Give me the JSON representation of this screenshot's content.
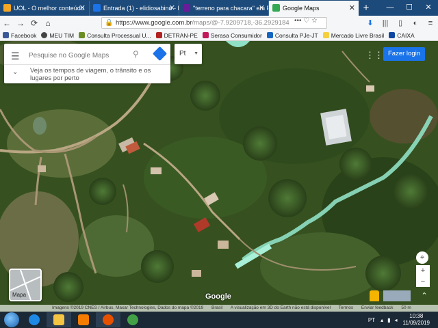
{
  "tabs": [
    {
      "title": "UOL - O melhor conteúdo",
      "favicon_color": "#f5a623",
      "active": false
    },
    {
      "title": "Entrada (1) - elidiosabino - E",
      "favicon_color": "#1a73e8",
      "active": false
    },
    {
      "title": "\"terreno para chacara\" em P",
      "favicon_color": "#6a1b9a",
      "active": false
    },
    {
      "title": "Google Maps",
      "favicon_color": "#34a853",
      "active": true
    }
  ],
  "url": {
    "main": "https://www.google.com.br",
    "rest": "/maps/@-7.9209718,-36.2929184"
  },
  "bookmarks": [
    {
      "label": "Facebook",
      "color": "#3b5998"
    },
    {
      "label": "MEU TIM",
      "color": "#444444"
    },
    {
      "label": "Consulta Processual U...",
      "color": "#6b8e23"
    },
    {
      "label": "DETRAN-PE",
      "color": "#b22222"
    },
    {
      "label": "Serasa Consumidor",
      "color": "#c2185b"
    },
    {
      "label": "Consulta PJe-JT",
      "color": "#1565c0"
    },
    {
      "label": "Mercado Livre Brasil",
      "color": "#f4d03f"
    },
    {
      "label": "CAIXA",
      "color": "#0d47a1"
    }
  ],
  "search": {
    "placeholder": "Pesquise no Google Maps",
    "hint": "Veja os tempos de viagem, o trânsito e os lugares por perto"
  },
  "lang_label": "Pt",
  "login_label": "Fazer login",
  "layer_label": "Mapa",
  "logo_text": "Google",
  "footer": [
    "Imagens ©2019 CNES / Airbus, Maxar Technologies, Dados do mapa ©2019",
    "Brasil",
    "A visualização em 3D do Earth não está disponível",
    "Termos",
    "Enviar feedback",
    "50 m"
  ],
  "taskbar": {
    "lang": "PT",
    "time": "10:38",
    "date": "11/09/2019",
    "apps": [
      {
        "name": "ie",
        "color": "#1e88e5"
      },
      {
        "name": "explorer",
        "color": "#f4c542"
      },
      {
        "name": "media",
        "color": "#f57c00"
      },
      {
        "name": "firefox",
        "color": "#e65100"
      },
      {
        "name": "chrome",
        "color": "#43a047"
      }
    ]
  },
  "colors": {
    "accent": "#1a73e8",
    "tabbar": "#1c4a7a",
    "water": "#8fe0c4"
  }
}
